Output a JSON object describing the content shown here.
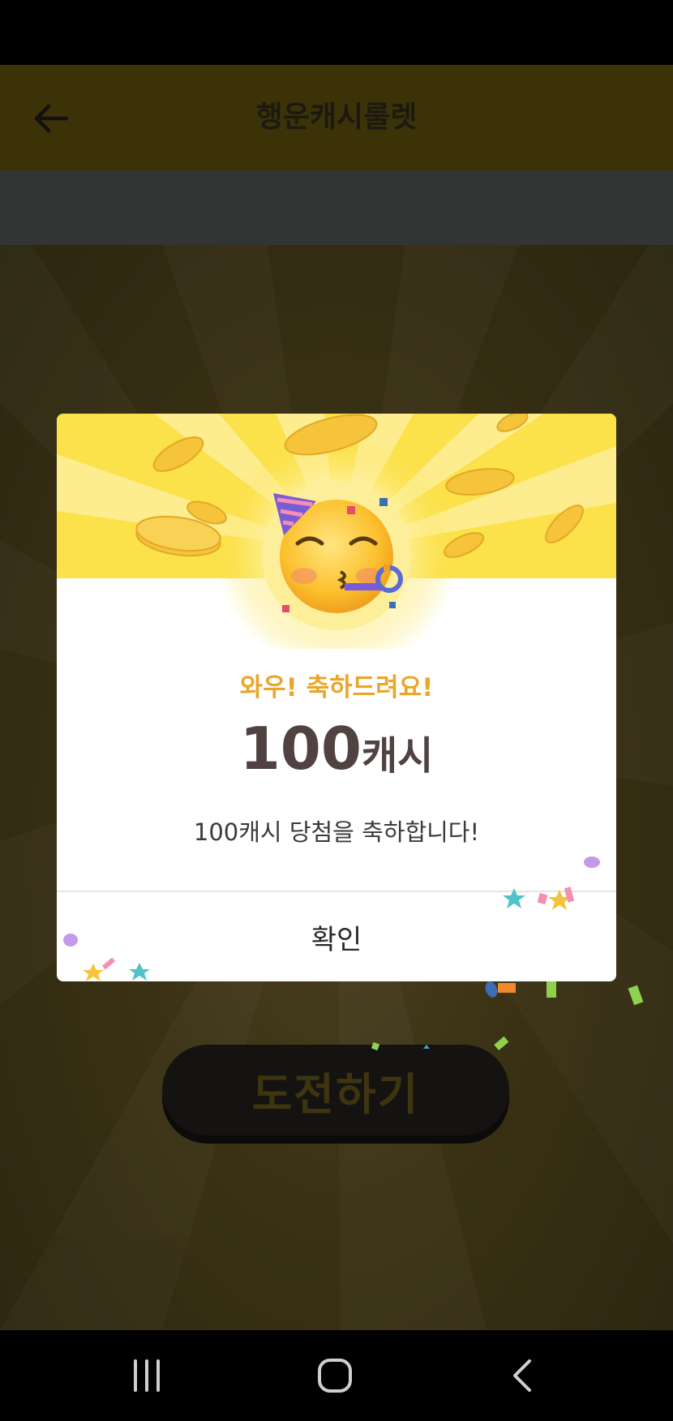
{
  "header": {
    "title": "행운캐시룰렛",
    "back_icon": "arrow-left-icon"
  },
  "main": {
    "challenge_button_label": "도전하기"
  },
  "dialog": {
    "emoji_icon": "partying-face-icon",
    "subtitle": "와우! 축하드려요!",
    "amount_value": "100",
    "amount_unit": "캐시",
    "message": "100캐시 당첨을 축하합니다!",
    "confirm_label": "확인"
  },
  "navigation": {
    "recent_icon": "recent-apps-icon",
    "home_icon": "home-icon",
    "back_icon": "back-chevron-icon"
  },
  "colors": {
    "accent": "#fbe14a",
    "subtitle": "#eaa62a",
    "amount": "#4f4240"
  }
}
